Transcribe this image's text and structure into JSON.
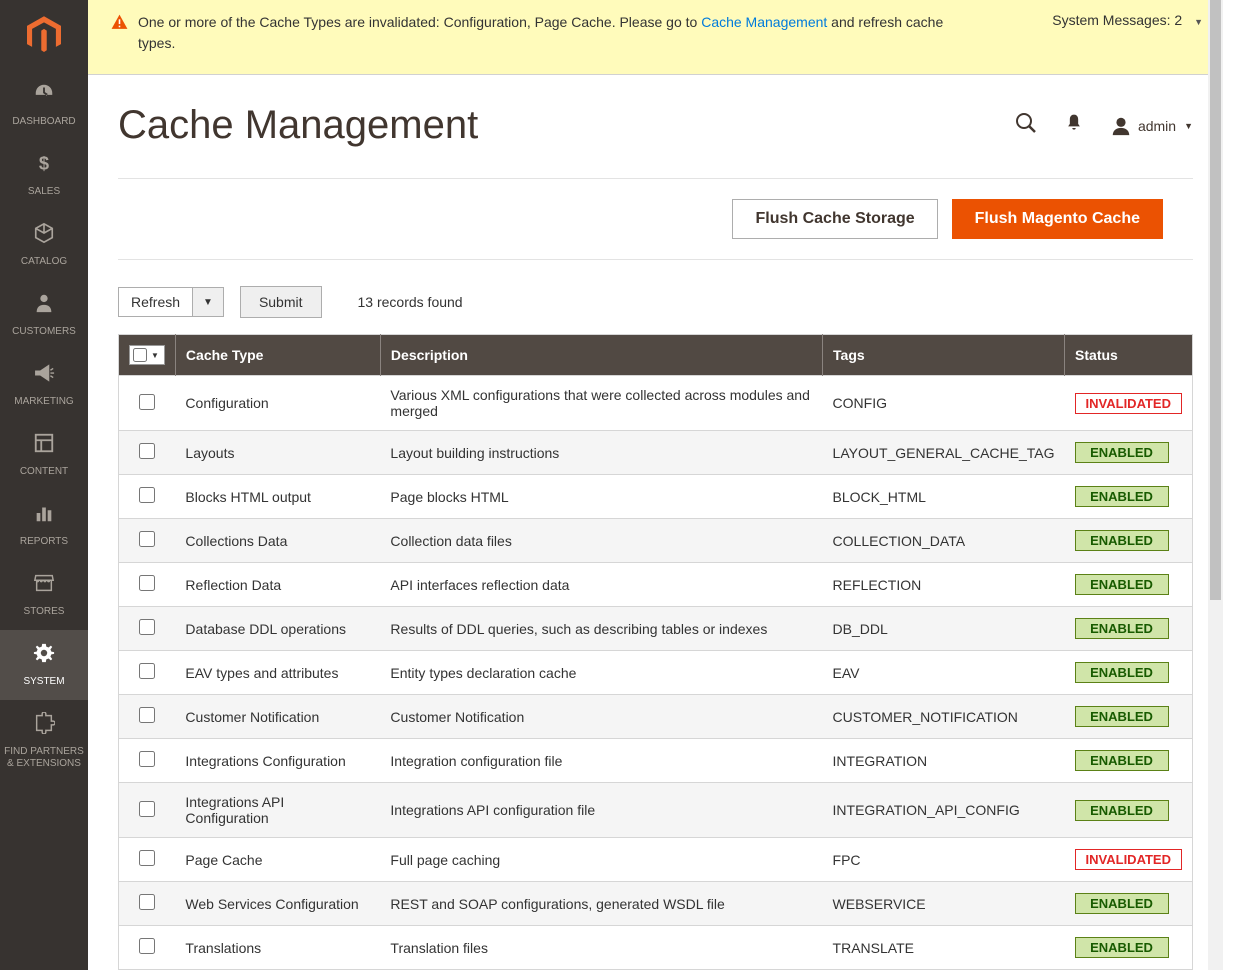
{
  "sidebar": {
    "items": [
      {
        "id": "dashboard",
        "label": "DASHBOARD",
        "icon": "dashboard"
      },
      {
        "id": "sales",
        "label": "SALES",
        "icon": "dollar"
      },
      {
        "id": "catalog",
        "label": "CATALOG",
        "icon": "box"
      },
      {
        "id": "customers",
        "label": "CUSTOMERS",
        "icon": "person"
      },
      {
        "id": "marketing",
        "label": "MARKETING",
        "icon": "megaphone"
      },
      {
        "id": "content",
        "label": "CONTENT",
        "icon": "blocks"
      },
      {
        "id": "reports",
        "label": "REPORTS",
        "icon": "bars"
      },
      {
        "id": "stores",
        "label": "STORES",
        "icon": "storefront"
      },
      {
        "id": "system",
        "label": "SYSTEM",
        "icon": "gear",
        "active": true
      },
      {
        "id": "partners",
        "label": "FIND PARTNERS & EXTENSIONS",
        "icon": "puzzle"
      }
    ]
  },
  "systemMessage": {
    "prefix": "One or more of the Cache Types are invalidated: Configuration, Page Cache. Please go to ",
    "link": "Cache Management",
    "suffix": " and refresh cache types.",
    "countLabel": "System Messages",
    "count": "2"
  },
  "header": {
    "title": "Cache Management",
    "user": "admin"
  },
  "actions": {
    "flushStorage": "Flush Cache Storage",
    "flushMagento": "Flush Magento Cache"
  },
  "toolbar": {
    "action": "Refresh",
    "submit": "Submit",
    "recordsFound": "13 records found"
  },
  "table": {
    "columns": {
      "cacheType": "Cache Type",
      "description": "Description",
      "tags": "Tags",
      "status": "Status"
    },
    "rows": [
      {
        "cacheType": "Configuration",
        "description": "Various XML configurations that were collected across modules and merged",
        "tags": "CONFIG",
        "status": "INVALIDATED"
      },
      {
        "cacheType": "Layouts",
        "description": "Layout building instructions",
        "tags": "LAYOUT_GENERAL_CACHE_TAG",
        "status": "ENABLED"
      },
      {
        "cacheType": "Blocks HTML output",
        "description": "Page blocks HTML",
        "tags": "BLOCK_HTML",
        "status": "ENABLED"
      },
      {
        "cacheType": "Collections Data",
        "description": "Collection data files",
        "tags": "COLLECTION_DATA",
        "status": "ENABLED"
      },
      {
        "cacheType": "Reflection Data",
        "description": "API interfaces reflection data",
        "tags": "REFLECTION",
        "status": "ENABLED"
      },
      {
        "cacheType": "Database DDL operations",
        "description": "Results of DDL queries, such as describing tables or indexes",
        "tags": "DB_DDL",
        "status": "ENABLED"
      },
      {
        "cacheType": "EAV types and attributes",
        "description": "Entity types declaration cache",
        "tags": "EAV",
        "status": "ENABLED"
      },
      {
        "cacheType": "Customer Notification",
        "description": "Customer Notification",
        "tags": "CUSTOMER_NOTIFICATION",
        "status": "ENABLED"
      },
      {
        "cacheType": "Integrations Configuration",
        "description": "Integration configuration file",
        "tags": "INTEGRATION",
        "status": "ENABLED"
      },
      {
        "cacheType": "Integrations API Configuration",
        "description": "Integrations API configuration file",
        "tags": "INTEGRATION_API_CONFIG",
        "status": "ENABLED"
      },
      {
        "cacheType": "Page Cache",
        "description": "Full page caching",
        "tags": "FPC",
        "status": "INVALIDATED"
      },
      {
        "cacheType": "Web Services Configuration",
        "description": "REST and SOAP configurations, generated WSDL file",
        "tags": "WEBSERVICE",
        "status": "ENABLED"
      },
      {
        "cacheType": "Translations",
        "description": "Translation files",
        "tags": "TRANSLATE",
        "status": "ENABLED"
      }
    ]
  }
}
